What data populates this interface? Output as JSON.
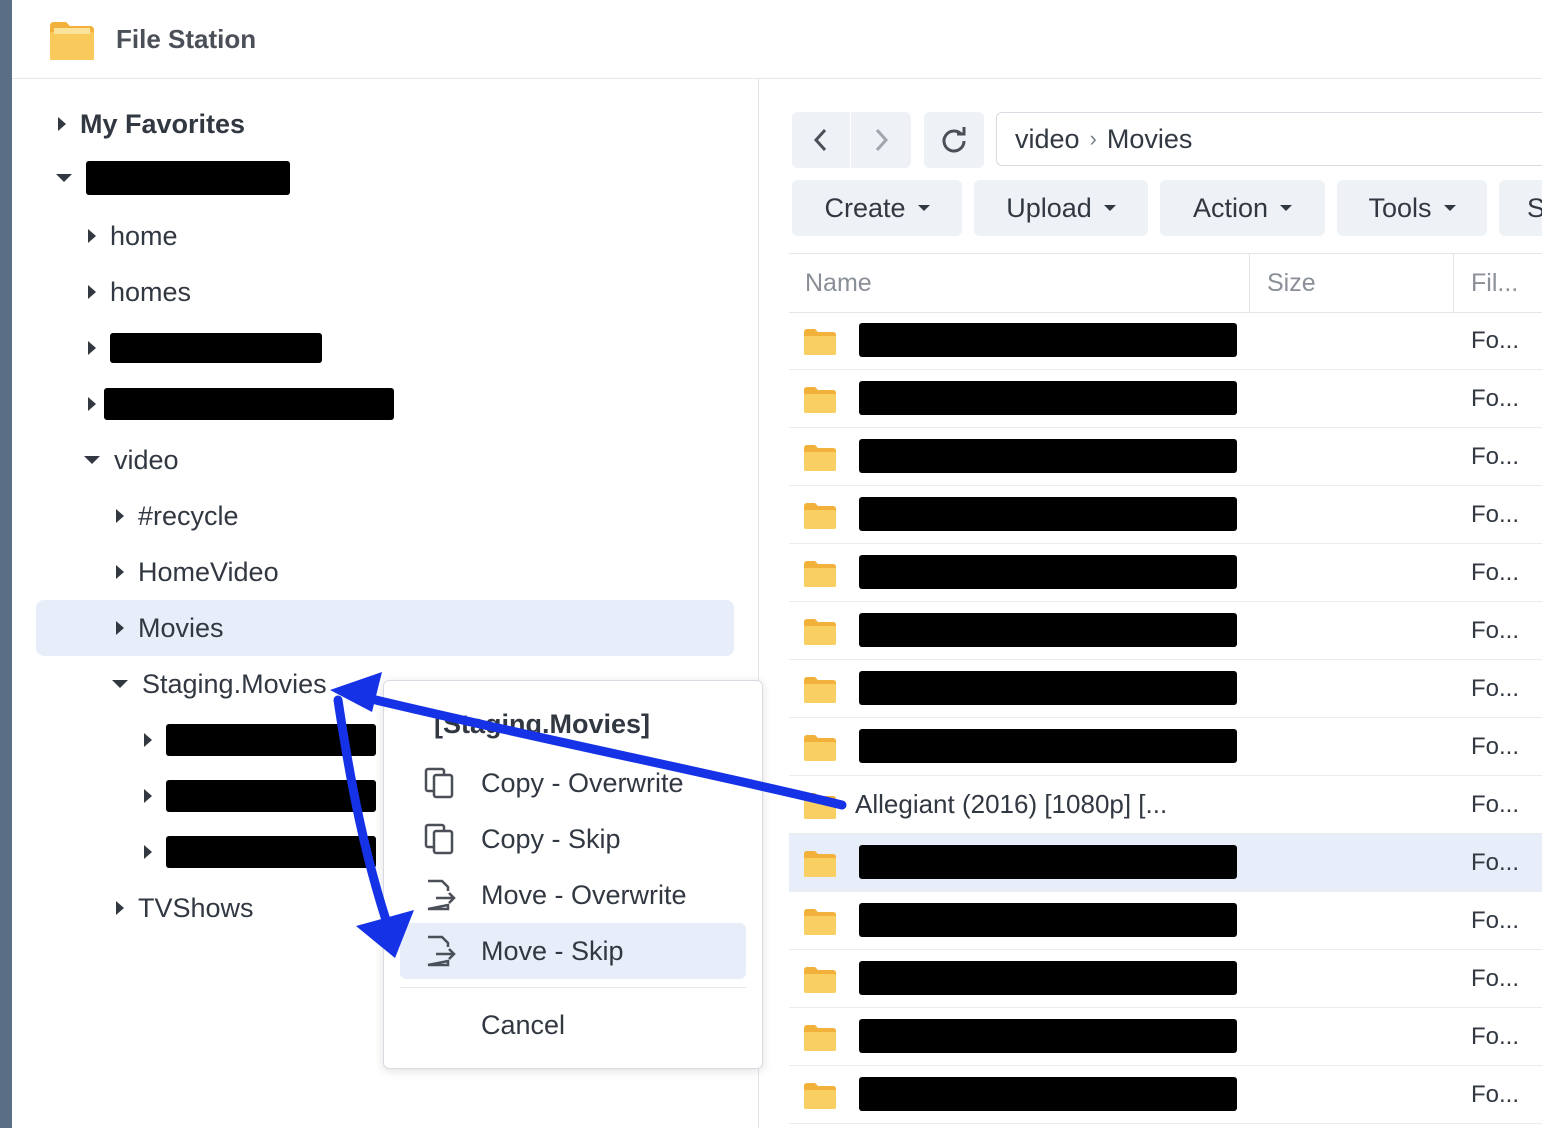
{
  "app": {
    "title": "File Station"
  },
  "tree": {
    "favorites": "My Favorites",
    "home": "home",
    "homes": "homes",
    "video": "video",
    "recycle": "#recycle",
    "homevideo": "HomeVideo",
    "movies": "Movies",
    "staging": "Staging.Movies",
    "tvshows": "TVShows"
  },
  "path": {
    "root": "video",
    "current": "Movies"
  },
  "toolbar": {
    "create": "Create",
    "upload": "Upload",
    "action": "Action",
    "tools": "Tools",
    "more": "S"
  },
  "grid": {
    "columns": {
      "name": "Name",
      "size": "Size",
      "type": "Fil..."
    },
    "rows": [
      {
        "name": "",
        "type": "Fo..."
      },
      {
        "name": "",
        "type": "Fo..."
      },
      {
        "name": "",
        "type": "Fo..."
      },
      {
        "name": "",
        "type": "Fo..."
      },
      {
        "name": "",
        "type": "Fo..."
      },
      {
        "name": "",
        "type": "Fo..."
      },
      {
        "name": "",
        "type": "Fo..."
      },
      {
        "name": "",
        "type": "Fo..."
      },
      {
        "name": "Allegiant (2016) [1080p] [...",
        "type": "Fo..."
      },
      {
        "name": "",
        "type": "Fo..."
      },
      {
        "name": "",
        "type": "Fo..."
      },
      {
        "name": "",
        "type": "Fo..."
      },
      {
        "name": "",
        "type": "Fo..."
      },
      {
        "name": "",
        "type": "Fo..."
      }
    ]
  },
  "menu": {
    "title": "[Staging.Movies]",
    "copy_overwrite": "Copy - Overwrite",
    "copy_skip": "Copy - Skip",
    "move_overwrite": "Move - Overwrite",
    "move_skip": "Move - Skip",
    "cancel": "Cancel"
  },
  "colors": {
    "selection": "#e8eef9",
    "folder": "#f7c95a",
    "annotation": "#1532e6"
  }
}
